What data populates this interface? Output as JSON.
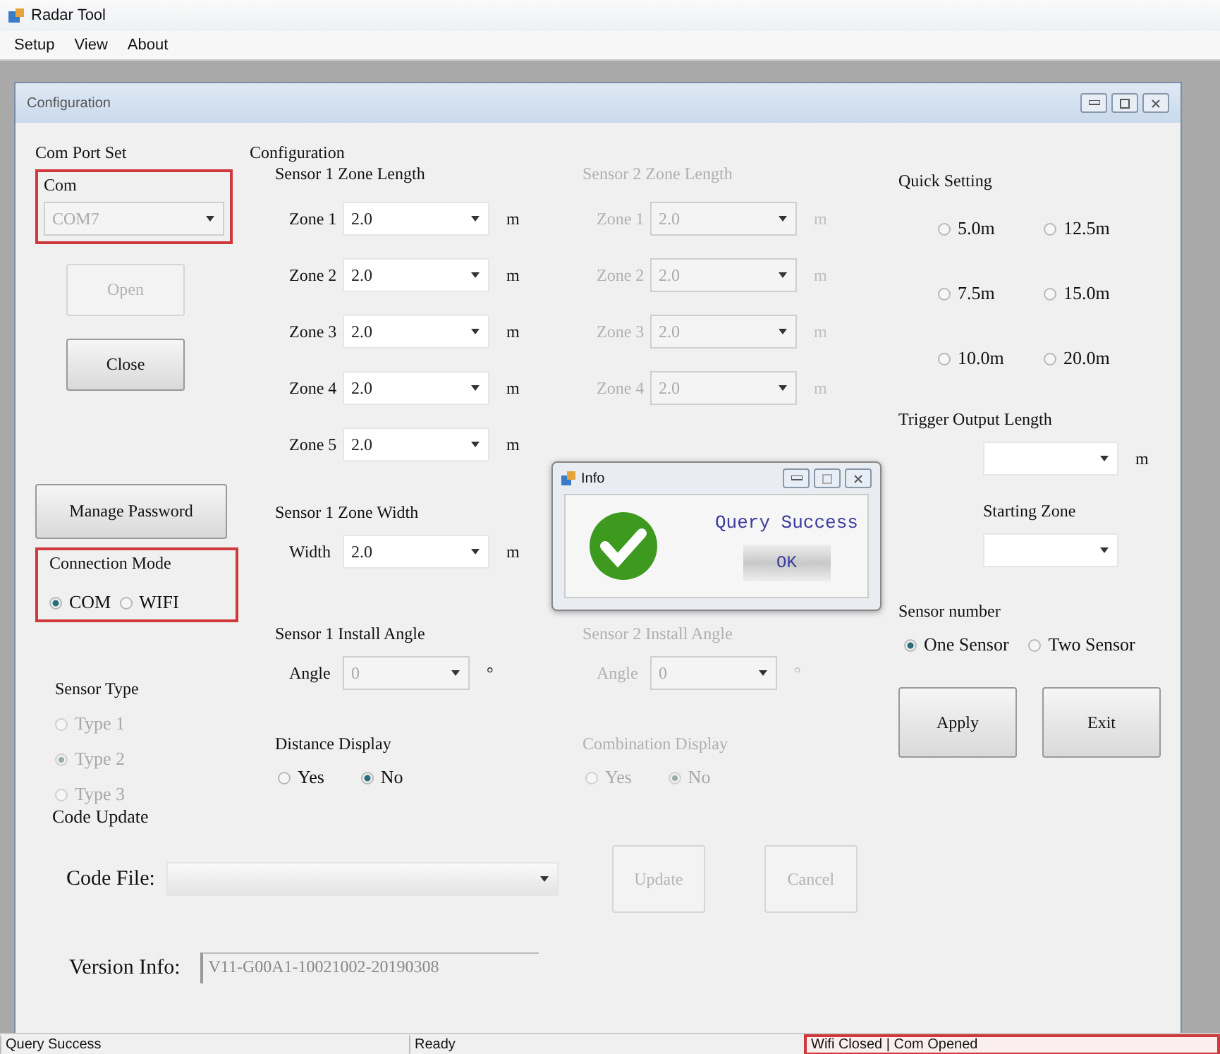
{
  "window": {
    "title": "Radar Tool"
  },
  "menu": [
    {
      "label": "Setup"
    },
    {
      "label": "View"
    },
    {
      "label": "About"
    }
  ],
  "child_window": {
    "title": "Configuration"
  },
  "com_port_set": {
    "title": "Com Port Set",
    "highlighted": true,
    "com_label": "Com",
    "com_value": "COM7",
    "buttons": [
      {
        "label": "Open",
        "disabled": true
      },
      {
        "label": "Close",
        "disabled": false
      }
    ]
  },
  "manage_password": {
    "label": "Manage Password"
  },
  "connection_mode": {
    "title": "Connection Mode",
    "highlighted": true,
    "options": [
      {
        "label": "COM",
        "selected": true
      },
      {
        "label": "WIFI",
        "selected": false
      }
    ]
  },
  "sensor_type": {
    "title": "Sensor Type",
    "disabled": true,
    "options": [
      {
        "label": "Type 1",
        "selected": false
      },
      {
        "label": "Type 2",
        "selected": true
      },
      {
        "label": "Type 3",
        "selected": false
      }
    ]
  },
  "configuration": {
    "title": "Configuration",
    "sensors": [
      {
        "disabled": false,
        "zone_length_title": "Sensor 1 Zone Length",
        "zones": [
          {
            "label": "Zone 1",
            "value": "2.0",
            "unit": "m"
          },
          {
            "label": "Zone 2",
            "value": "2.0",
            "unit": "m"
          },
          {
            "label": "Zone 3",
            "value": "2.0",
            "unit": "m"
          },
          {
            "label": "Zone 4",
            "value": "2.0",
            "unit": "m"
          },
          {
            "label": "Zone 5",
            "value": "2.0",
            "unit": "m"
          }
        ],
        "width_title": "Sensor 1 Zone Width",
        "width": {
          "label": "Width",
          "value": "2.0",
          "unit": "m"
        },
        "angle_title": "Sensor 1 Install Angle",
        "angle": {
          "label": "Angle",
          "value": "0",
          "unit": "°"
        },
        "display_title": "Distance Display",
        "display_options": [
          {
            "label": "Yes",
            "selected": false
          },
          {
            "label": "No",
            "selected": true
          }
        ]
      },
      {
        "disabled": true,
        "zone_length_title": "Sensor 2 Zone Length",
        "zones": [
          {
            "label": "Zone 1",
            "value": "2.0",
            "unit": "m"
          },
          {
            "label": "Zone 2",
            "value": "2.0",
            "unit": "m"
          },
          {
            "label": "Zone 3",
            "value": "2.0",
            "unit": "m"
          },
          {
            "label": "Zone 4",
            "value": "2.0",
            "unit": "m"
          }
        ],
        "angle_title": "Sensor 2 Install Angle",
        "angle": {
          "label": "Angle",
          "value": "0",
          "unit": "°"
        },
        "display_title": "Combination Display",
        "display_options": [
          {
            "label": "Yes",
            "selected": false
          },
          {
            "label": "No",
            "selected": true
          }
        ]
      }
    ]
  },
  "quick_setting": {
    "title": "Quick Setting",
    "options": [
      {
        "label": "5.0m",
        "selected": false
      },
      {
        "label": "12.5m",
        "selected": false
      },
      {
        "label": "7.5m",
        "selected": false
      },
      {
        "label": "15.0m",
        "selected": false
      },
      {
        "label": "10.0m",
        "selected": false
      },
      {
        "label": "20.0m",
        "selected": false
      }
    ]
  },
  "trigger_output": {
    "title": "Trigger Output Length",
    "unit": "m"
  },
  "starting_zone": {
    "title": "Starting Zone"
  },
  "sensor_number": {
    "title": "Sensor number",
    "options": [
      {
        "label": "One Sensor",
        "selected": true
      },
      {
        "label": "Two Sensor",
        "selected": false
      }
    ]
  },
  "actions": [
    {
      "label": "Apply"
    },
    {
      "label": "Exit"
    }
  ],
  "code_update": {
    "title": "Code Update",
    "file_label": "Code File:",
    "buttons": [
      {
        "label": "Update",
        "disabled": true
      },
      {
        "label": "Cancel",
        "disabled": true
      }
    ],
    "version_label": "Version Info:",
    "version_value": "V11-G00A1-10021002-20190308"
  },
  "dialog": {
    "title": "Info",
    "message": "Query Success",
    "button": "OK"
  },
  "status_bar": [
    {
      "text": "Query Success",
      "highlighted": false
    },
    {
      "text": "Ready",
      "highlighted": false
    },
    {
      "text": "Wifi Closed | Com Opened",
      "highlighted": true
    }
  ]
}
